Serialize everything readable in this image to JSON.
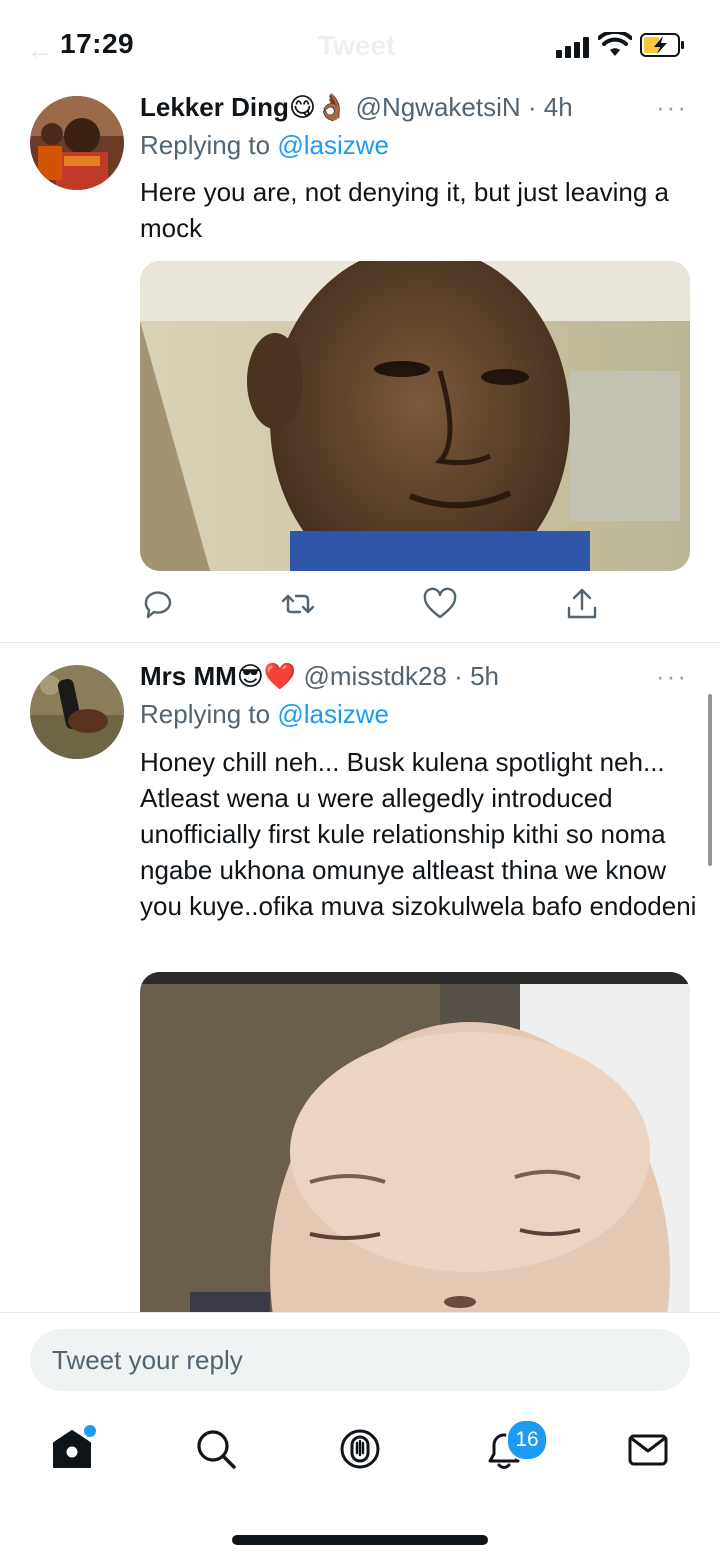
{
  "status_bar": {
    "time": "17:29",
    "ghost_title": "Tweet",
    "battery": "charging"
  },
  "tweets": [
    {
      "name": "Lekker Ding",
      "name_emoji": "😋👌🏾",
      "handle": "@NgwaketsiN",
      "age": "4h",
      "replying_prefix": "Replying to",
      "replying_to": "@lasizwe",
      "text": "Here you are, not denying it, but just leaving a mock",
      "media": "photo-man-squinting",
      "actions": [
        "reply-icon",
        "retweet-icon",
        "like-icon",
        "share-icon"
      ]
    },
    {
      "name": "Mrs MM",
      "name_emoji": "😎❤️",
      "handle": "@misstdk28",
      "age": "5h",
      "replying_prefix": "Replying to",
      "replying_to": "@lasizwe",
      "text": "Honey chill neh... Busk kulena spotlight neh... Atleast wena u were allegedly introduced unofficially first kule relationship kithi so noma ngabe ukhona omunye altleast thina we know you kuye..ofika muva sizokulwela bafo endodeni",
      "media": "photo-sleeping-baby"
    }
  ],
  "more_glyph": "···",
  "dot": "·",
  "reply_box": {
    "placeholder": "Tweet your reply"
  },
  "tab_bar": {
    "items": [
      "home-icon",
      "search-icon",
      "spaces-icon",
      "notifications-icon",
      "messages-icon"
    ],
    "notifications_badge": "16",
    "accent": "#1d9bf0"
  }
}
